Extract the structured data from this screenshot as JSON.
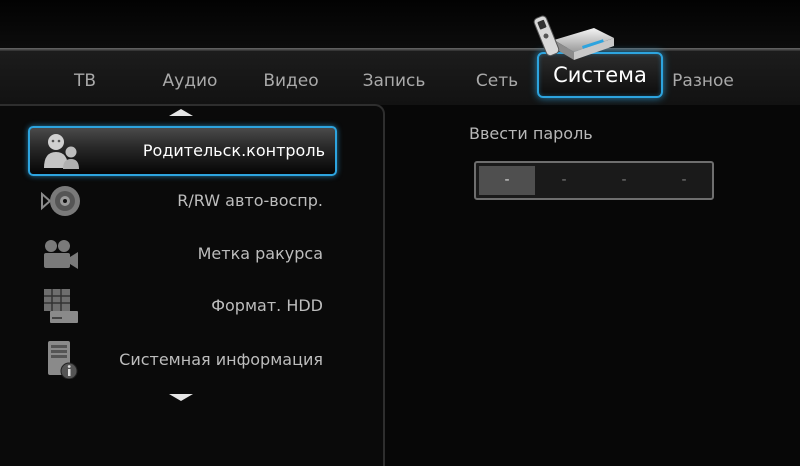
{
  "tabs": [
    {
      "label": "ТВ"
    },
    {
      "label": "Аудио"
    },
    {
      "label": "Видео"
    },
    {
      "label": "Запись"
    },
    {
      "label": "Сеть"
    },
    {
      "label": "Система",
      "active": true
    },
    {
      "label": "Разное"
    }
  ],
  "active_tab_icon": "media-player-remote-icon",
  "menu": {
    "items": [
      {
        "label": "Родительск.контроль",
        "icon": "parental-control-icon",
        "selected": true
      },
      {
        "label": "R/RW авто-воспр.",
        "icon": "disc-autoplay-icon"
      },
      {
        "label": "Метка ракурса",
        "icon": "camera-angle-icon"
      },
      {
        "label": "Формат. HDD",
        "icon": "hdd-format-icon"
      },
      {
        "label": "Системная информация",
        "icon": "system-info-icon"
      }
    ]
  },
  "password": {
    "label": "Ввести пароль",
    "cells": [
      "-",
      "-",
      "-",
      "-"
    ],
    "active_index": 0
  },
  "colors": {
    "accent": "#2da4df",
    "background": "#070707",
    "text": "#c8c8c8"
  }
}
